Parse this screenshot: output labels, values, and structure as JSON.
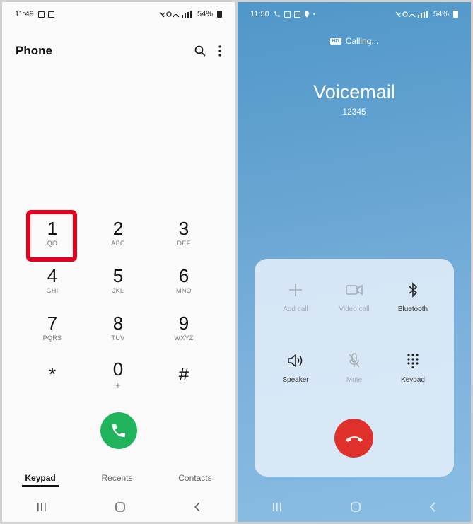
{
  "left": {
    "status": {
      "time": "11:49",
      "battery": "54%"
    },
    "title": "Phone",
    "keys": [
      {
        "digit": "1",
        "letters": "QO"
      },
      {
        "digit": "2",
        "letters": "ABC"
      },
      {
        "digit": "3",
        "letters": "DEF"
      },
      {
        "digit": "4",
        "letters": "GHI"
      },
      {
        "digit": "5",
        "letters": "JKL"
      },
      {
        "digit": "6",
        "letters": "MNO"
      },
      {
        "digit": "7",
        "letters": "PQRS"
      },
      {
        "digit": "8",
        "letters": "TUV"
      },
      {
        "digit": "9",
        "letters": "WXYZ"
      },
      {
        "digit": "*",
        "letters": ""
      },
      {
        "digit": "0",
        "letters": "+"
      },
      {
        "digit": "#",
        "letters": ""
      }
    ],
    "tabs": [
      "Keypad",
      "Recents",
      "Contacts"
    ],
    "colors": {
      "call": "#1fb45c",
      "highlight": "#e4001c"
    }
  },
  "right": {
    "status": {
      "time": "11:50",
      "battery": "54%"
    },
    "calling": "Calling...",
    "contact_name": "Voicemail",
    "contact_number": "12345",
    "buttons": [
      {
        "label": "Add call",
        "icon": "plus-icon",
        "enabled": false
      },
      {
        "label": "Video call",
        "icon": "video-icon",
        "enabled": false
      },
      {
        "label": "Bluetooth",
        "icon": "bluetooth-icon",
        "enabled": true
      },
      {
        "label": "Speaker",
        "icon": "speaker-icon",
        "enabled": true
      },
      {
        "label": "Mute",
        "icon": "mic-off-icon",
        "enabled": false
      },
      {
        "label": "Keypad",
        "icon": "dialpad-icon",
        "enabled": true
      }
    ],
    "colors": {
      "end_call": "#e0302b"
    }
  }
}
